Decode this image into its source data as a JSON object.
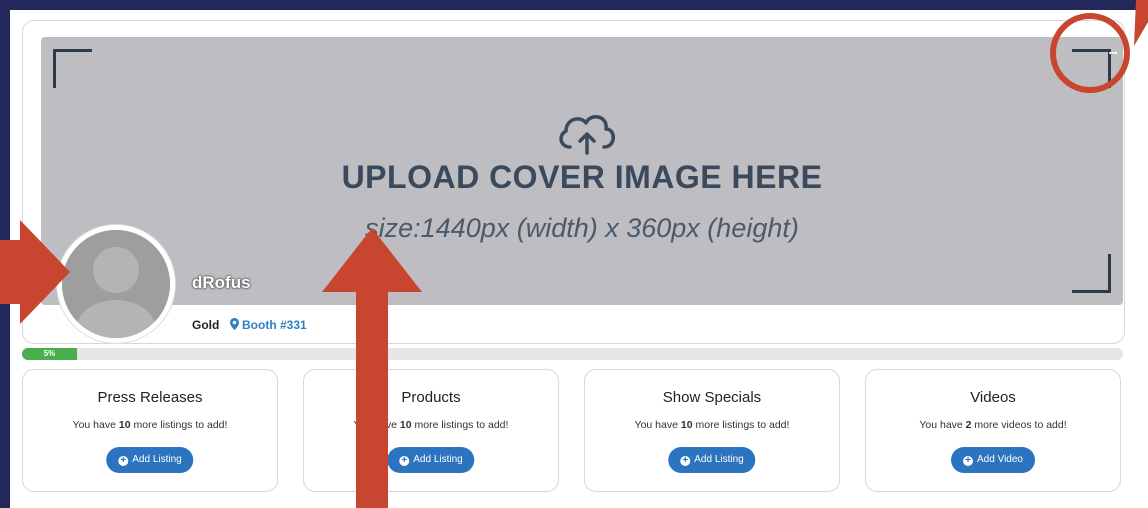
{
  "cover": {
    "title": "UPLOAD COVER IMAGE HERE",
    "size_hint": "size:1440px (width) x 360px (height)",
    "menu_dots": "...",
    "icon": "cloud-upload-icon"
  },
  "profile": {
    "company_name": "dRofus",
    "membership": "Gold",
    "booth": "Booth #331"
  },
  "progress": {
    "label": "5%",
    "value": 0.05
  },
  "cards": [
    {
      "title": "Press Releases",
      "prefix": "You have ",
      "count": "10",
      "suffix": " more listings to add!",
      "button": "Add Listing"
    },
    {
      "title": "Products",
      "prefix": "You have ",
      "count": "10",
      "suffix": " more listings to add!",
      "button": "Add Listing"
    },
    {
      "title": "Show Specials",
      "prefix": "You have ",
      "count": "10",
      "suffix": " more listings to add!",
      "button": "Add Listing"
    },
    {
      "title": "Videos",
      "prefix": "You have ",
      "count": "2",
      "suffix": " more videos to add!",
      "button": "Add Video"
    }
  ],
  "colors": {
    "frame": "#23285a",
    "annotation": "#c8452f",
    "button": "#2c74c0",
    "progress": "#4aae4e",
    "link": "#2d7fc5"
  }
}
